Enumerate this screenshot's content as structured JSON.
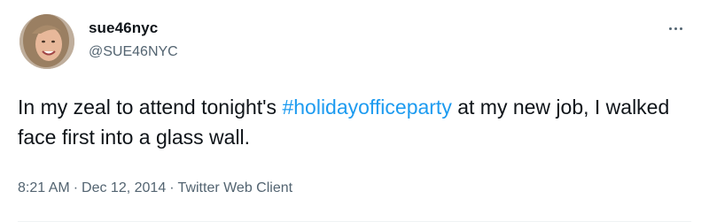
{
  "user": {
    "display_name": "sue46nyc",
    "handle": "@SUE46NYC",
    "avatar_icon": "profile-photo"
  },
  "tweet": {
    "text_before": "In my zeal to attend tonight's ",
    "hashtag": "#holidayofficeparty",
    "text_after": " at my new job, I walked face first into a glass wall."
  },
  "meta": {
    "time": "8:21 AM",
    "separator": "·",
    "date": "Dec 12, 2014",
    "client": "Twitter Web Client"
  },
  "colors": {
    "text": "#0f1419",
    "secondary": "#536471",
    "link": "#1d9bf0"
  },
  "more_icon": "more-options-icon"
}
